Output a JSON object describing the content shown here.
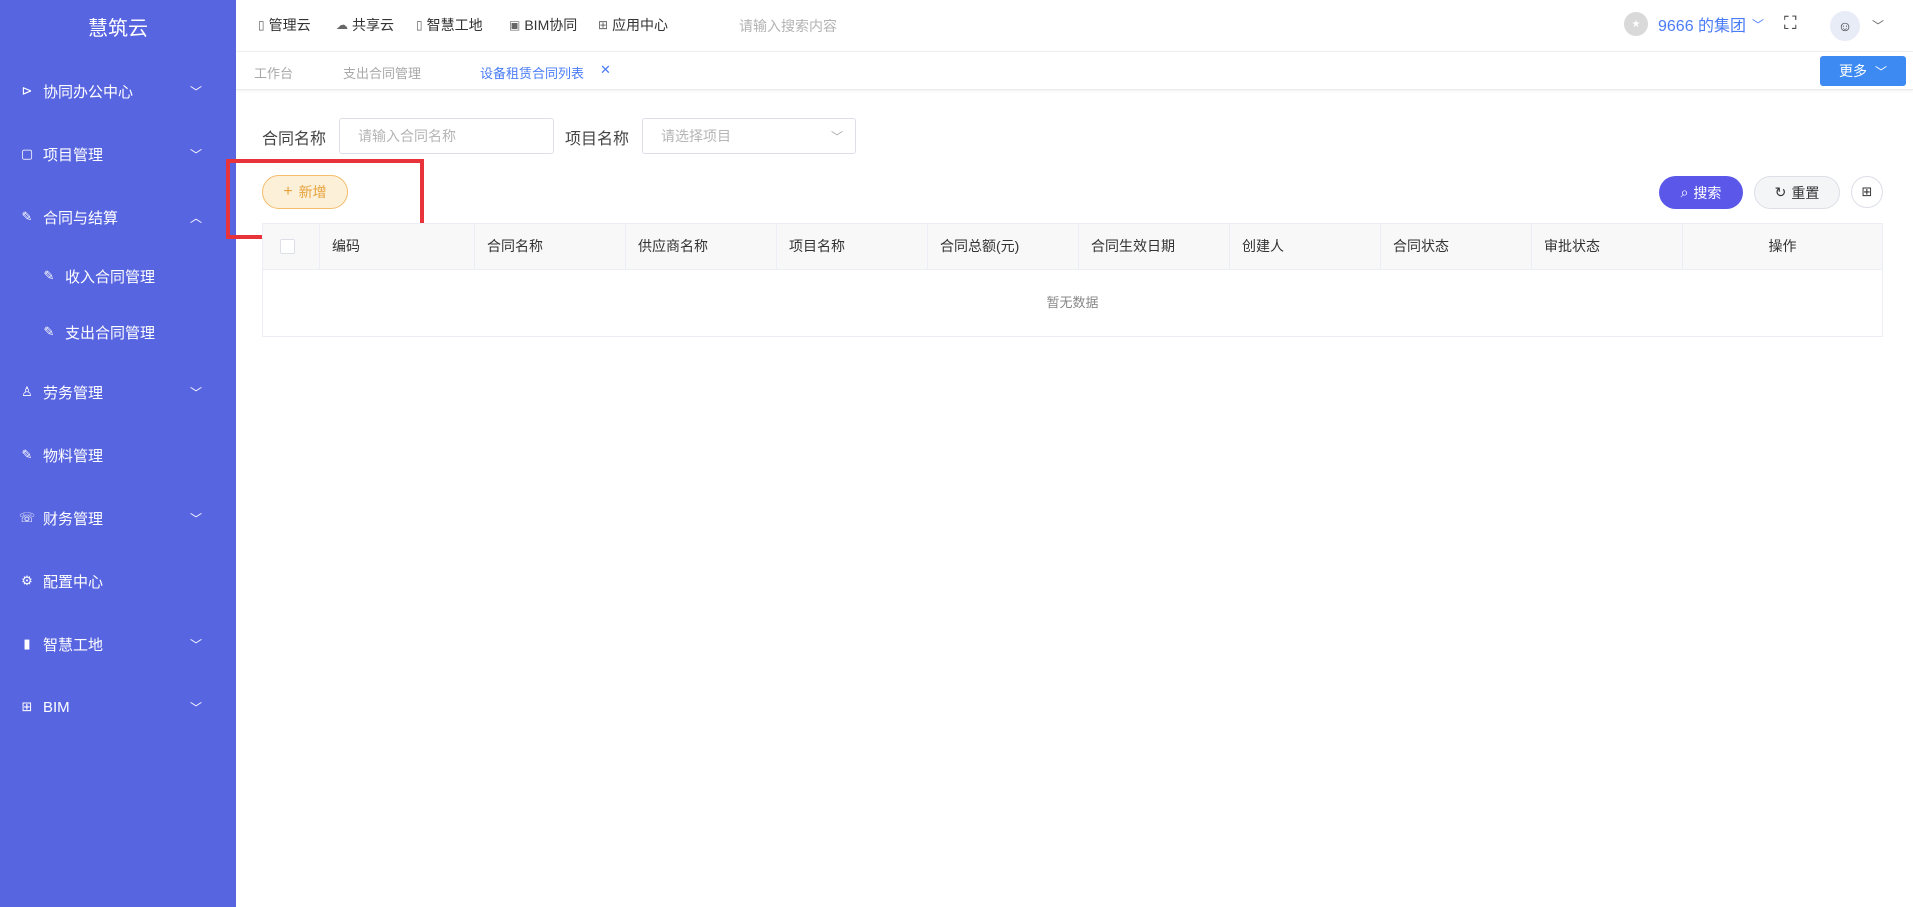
{
  "sidebar": {
    "brand": "慧筑云",
    "items": [
      {
        "label": "协同办公中心",
        "icon": "send-icon",
        "glyph": "⊳",
        "expanded": false
      },
      {
        "label": "项目管理",
        "icon": "book-icon",
        "glyph": "▢",
        "expanded": false
      },
      {
        "label": "合同与结算",
        "icon": "edit-doc-icon",
        "glyph": "✎",
        "expanded": true
      },
      {
        "label": "收入合同管理",
        "icon": "edit-doc-icon",
        "glyph": "✎"
      },
      {
        "label": "支出合同管理",
        "icon": "edit-doc-icon",
        "glyph": "✎"
      },
      {
        "label": "劳务管理",
        "icon": "worker-icon",
        "glyph": "♙",
        "expanded": false
      },
      {
        "label": "物料管理",
        "icon": "edit-doc-icon",
        "glyph": "✎"
      },
      {
        "label": "财务管理",
        "icon": "phone-icon",
        "glyph": "☏",
        "expanded": false
      },
      {
        "label": "配置中心",
        "icon": "gear-icon",
        "glyph": "⚙"
      },
      {
        "label": "智慧工地",
        "icon": "bar-chart-icon",
        "glyph": "▮",
        "expanded": false
      },
      {
        "label": "BIM",
        "icon": "grid-icon",
        "glyph": "⊞",
        "expanded": false
      }
    ]
  },
  "topnav": {
    "items": [
      {
        "label": "管理云",
        "icon": "doc-icon",
        "glyph": "▯"
      },
      {
        "label": "共享云",
        "icon": "cloud-icon",
        "glyph": "☁"
      },
      {
        "label": "智慧工地",
        "icon": "book-icon",
        "glyph": "▯"
      },
      {
        "label": "BIM协同",
        "icon": "cube-icon",
        "glyph": "▣"
      },
      {
        "label": "应用中心",
        "icon": "apps-icon",
        "glyph": "⊞"
      }
    ],
    "search_placeholder": "请输入搜索内容",
    "org_name": "9666 的集团"
  },
  "tabs": {
    "items": [
      "工作台",
      "支出合同管理",
      "设备租赁合同列表"
    ],
    "active_index": 2,
    "more_label": "更多"
  },
  "filters": {
    "contract_name_label": "合同名称",
    "contract_name_placeholder": "请输入合同名称",
    "project_name_label": "项目名称",
    "project_name_placeholder": "请选择项目"
  },
  "actions": {
    "add_label": "新增",
    "search_label": "搜索",
    "reset_label": "重置"
  },
  "table": {
    "columns": [
      "编码",
      "合同名称",
      "供应商名称",
      "项目名称",
      "合同总额(元)",
      "合同生效日期",
      "创建人",
      "合同状态",
      "审批状态",
      "操作"
    ],
    "empty_text": "暂无数据"
  },
  "colors": {
    "sidebar_bg": "#5865e0",
    "primary": "#4a7cf7",
    "search_btn": "#5b57e8",
    "add_btn_text": "#e6a23c",
    "highlight": "#e8333b"
  }
}
